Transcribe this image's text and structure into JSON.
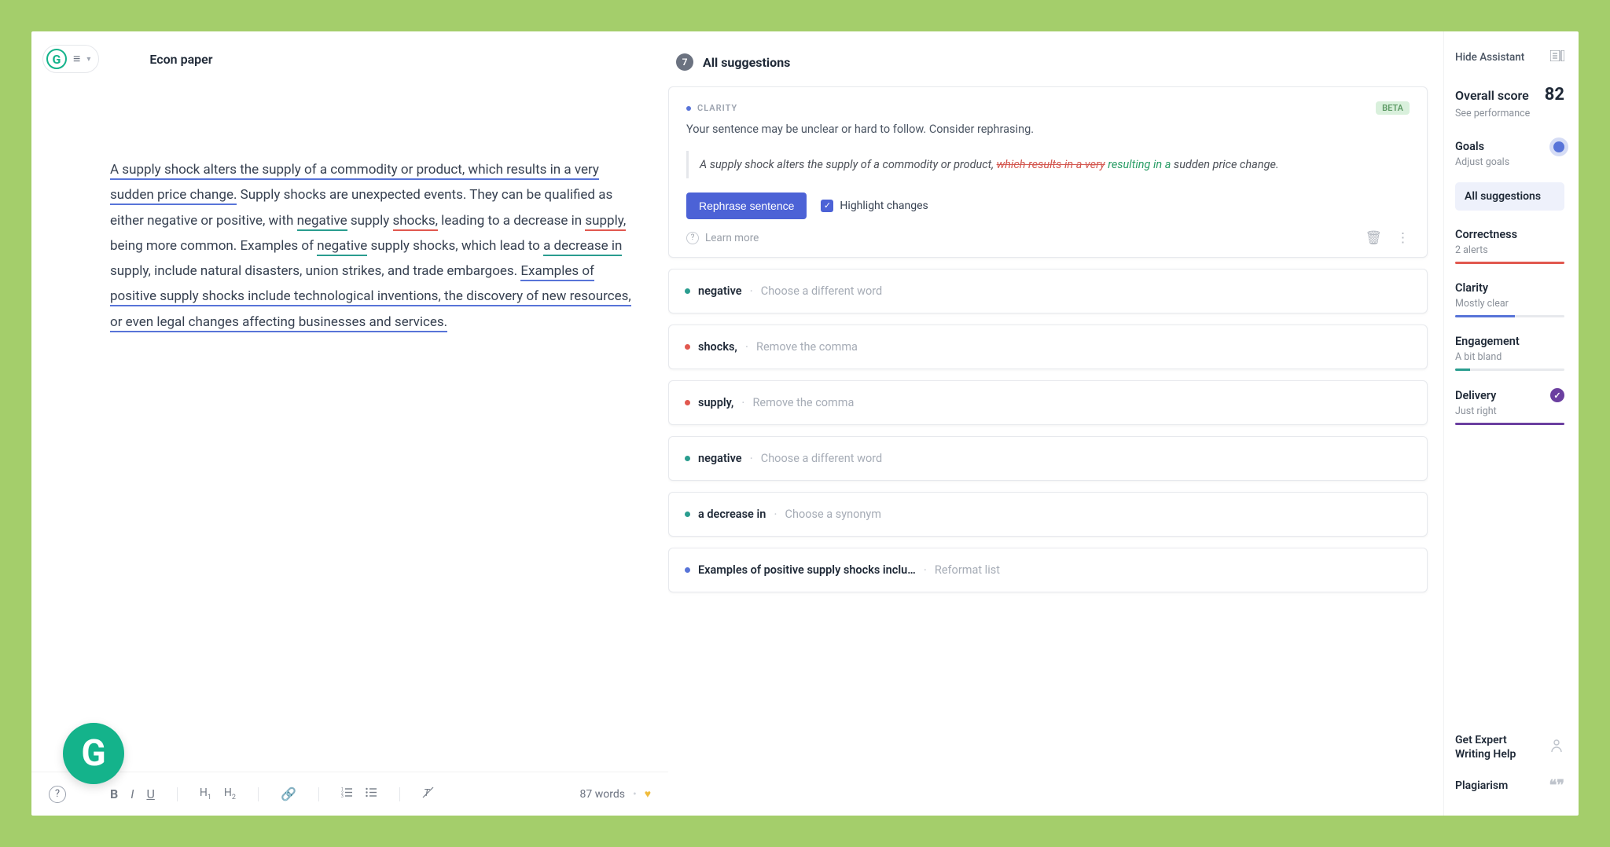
{
  "doc": {
    "title": "Econ paper",
    "word_count_label": "87 words"
  },
  "editor": {
    "s1": "A supply shock alters the supply of a commodity or product, which results in a very sudden price change.",
    "s2": " Supply shocks are unexpected events. They can be qualified as either negative or positive, with ",
    "w_negative1": "negative",
    "s3": " supply ",
    "w_shocks": "shocks,",
    "s4": " leading to a decrease in ",
    "w_supply": "supply,",
    "s5": " being more common. Examples of ",
    "w_negative2": "negative",
    "s6": " supply shocks, which lead to ",
    "w_decrease": "a decrease in",
    "s7": " supply, include natural disasters, union strikes, and trade embargoes. ",
    "s8": "Examples of positive supply shocks include technological inventions, the discovery of new resources, or even legal changes affecting businesses and services."
  },
  "suggestions": {
    "count": "7",
    "header": "All suggestions",
    "expanded": {
      "category": "CLARITY",
      "beta": "BETA",
      "desc": "Your sentence may be unclear or hard to follow. Consider rephrasing.",
      "quote_prefix": "A supply shock alters the supply of a commodity or product, ",
      "quote_strike": "which results in a very",
      "quote_insert": " resulting in a",
      "quote_suffix": " sudden price change.",
      "rephrase_btn": "Rephrase sentence",
      "highlight_label": "Highlight changes",
      "learn_more": "Learn more"
    },
    "items": [
      {
        "color": "teal",
        "term": "negative",
        "hint": "Choose a different word"
      },
      {
        "color": "red",
        "term": "shocks,",
        "hint": "Remove the comma"
      },
      {
        "color": "red",
        "term": "supply,",
        "hint": "Remove the comma"
      },
      {
        "color": "teal",
        "term": "negative",
        "hint": "Choose a different word"
      },
      {
        "color": "teal",
        "term": "a decrease in",
        "hint": "Choose a synonym"
      },
      {
        "color": "blue",
        "term": "Examples of positive supply shocks inclu…",
        "hint": "Reformat list"
      }
    ]
  },
  "assistant": {
    "hide": "Hide Assistant",
    "score_label": "Overall score",
    "score_value": "82",
    "score_sub": "See performance",
    "goals_label": "Goals",
    "goals_sub": "Adjust goals",
    "all_suggestions": "All suggestions",
    "dims": {
      "correctness": {
        "label": "Correctness",
        "sub": "2 alerts"
      },
      "clarity": {
        "label": "Clarity",
        "sub": "Mostly clear"
      },
      "engagement": {
        "label": "Engagement",
        "sub": "A bit bland"
      },
      "delivery": {
        "label": "Delivery",
        "sub": "Just right"
      }
    },
    "footer": {
      "help_l1": "Get Expert",
      "help_l2": "Writing Help",
      "plagiarism": "Plagiarism"
    }
  }
}
